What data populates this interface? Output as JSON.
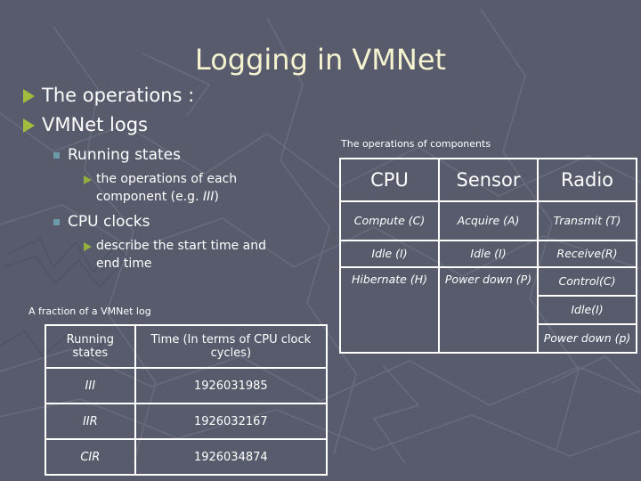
{
  "slide": {
    "title": "Logging in VMNet"
  },
  "bullets": {
    "level1": [
      {
        "text": "The operations :"
      },
      {
        "text": "VMNet logs"
      }
    ],
    "level2_a": "Running states",
    "level3_a_pre": "the operations of each component (e.g. ",
    "level3_a_em": "III",
    "level3_a_post": ")",
    "level2_b": "CPU clocks",
    "level3_b": "describe the start time and end time"
  },
  "log_table": {
    "caption": "A fraction of a VMNet log",
    "headers": [
      "Running states",
      "Time (In terms of CPU clock cycles)"
    ],
    "rows": [
      {
        "state": "III",
        "time": "1926031985"
      },
      {
        "state": "IIR",
        "time": "1926032167"
      },
      {
        "state": "CIR",
        "time": "1926034874"
      }
    ]
  },
  "ops_table": {
    "caption": "The operations of components",
    "headers": [
      "CPU",
      "Sensor",
      "Radio"
    ],
    "cpu": [
      "Compute (C)",
      "Idle (I)",
      "Hibernate (H)"
    ],
    "sensor": [
      "Acquire (A)",
      "Idle (I)",
      "Power down (P)"
    ],
    "radio": [
      "Transmit (T)",
      "Receive(R)",
      "Control(C)",
      "Idle(I)",
      "Power down (p)"
    ]
  },
  "colors": {
    "background": "#575b6c",
    "title": "#f5f3d0",
    "bullet_triangle": "#a3bc3f",
    "bullet_square": "#6d9aa8",
    "text": "#ffffff",
    "table_border": "#ffffff"
  }
}
